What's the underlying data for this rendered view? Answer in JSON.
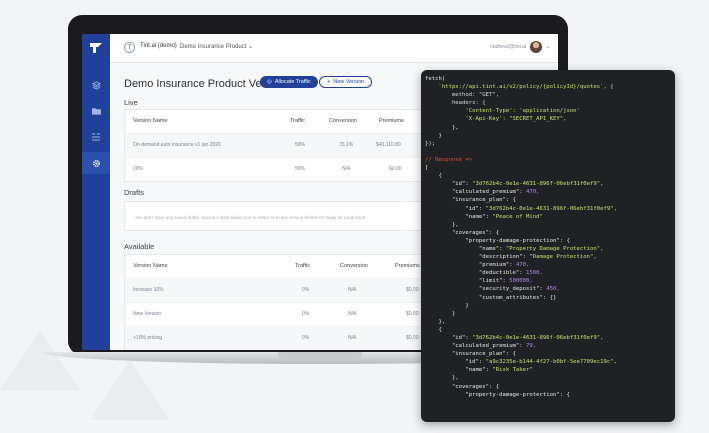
{
  "header": {
    "org_badge": "T",
    "org_name": "Tint.ai (demo)",
    "product_select": "Demo Insurance Product",
    "user_email": "matheus@tint.ai"
  },
  "page": {
    "title": "Demo Insurance Product Versions",
    "allocate_label": "Allocate Traffic",
    "new_version_label": "New Version"
  },
  "live": {
    "title": "Live",
    "columns": [
      "Version Name",
      "Traffic",
      "Conversion",
      "Premiums"
    ],
    "rows": [
      {
        "name": "On-demand auto insurance v1 jan 2020",
        "traffic": "50%",
        "conversion": "75.1%",
        "premiums": "$40,110.80"
      },
      {
        "name": "20%",
        "traffic": "50%",
        "conversion": "N/A",
        "premiums": "$0.00"
      }
    ]
  },
  "drafts": {
    "title": "Drafts",
    "empty": "You don't have any saved drafts. Saving a draft allows you to return to a new version before it's ready for production."
  },
  "available": {
    "title": "Available",
    "columns": [
      "Version Name",
      "Traffic",
      "Conversion",
      "Premiums"
    ],
    "rows": [
      {
        "name": "Increase 10%",
        "traffic": "0%",
        "conversion": "N/A",
        "premiums": "$0.00"
      },
      {
        "name": "New Version",
        "traffic": "0%",
        "conversion": "N/A",
        "premiums": "$0.00"
      },
      {
        "name": "+10% pricing",
        "traffic": "0%",
        "conversion": "N/A",
        "premiums": "$0.00"
      }
    ]
  },
  "code": {
    "request": [
      "fetch(",
      "    `https://api.tint.ai/v2/policy/{policyId}/quotes`, {",
      "        method: \"GET\",",
      "        headers: {",
      "            'Content-Type': 'application/json'",
      "            'X-Api-Key': \"SECRET_API_KEY\",",
      "        },",
      "    }",
      "});"
    ],
    "response_comment": "// Response =>",
    "response": [
      "[",
      "    {",
      "        \"id\": \"3d762b4c-0e1e-4631-896f-06ebf31f0ef9\",",
      "        \"calculated_premium\": 470,",
      "        \"insurance_plan\": {",
      "            \"id\": \"3d762b4c-0e1e-4631-896f-06ebf31f0ef9\",",
      "            \"name\": \"Peace of Mind\"",
      "        },",
      "        \"coverages\": {",
      "            \"property-damage-protection\": {",
      "                \"name\": \"Property Damage Protection\",",
      "                \"description\": \"Damage Protection\",",
      "                \"premium\": 470,",
      "                \"deductible\": 1500,",
      "                \"limit\": 500000,",
      "                \"security_deposit\": 450,",
      "                \"custom_attributes\": {}",
      "            }",
      "        }",
      "    },",
      "    {",
      "        \"id\": \"3d762b4c-0e1e-4631-896f-06ebf31f0ef9\",",
      "        \"calculated_premium\": 79,",
      "        \"insurance_plan\": {",
      "            \"id\": \"a9c3235e-b144-4f27-b0bf-5ee7709ec19c\",",
      "            \"name\": \"Risk Taker\"",
      "        },",
      "        \"coverages\": {",
      "            \"property-damage-protection\": {"
    ]
  }
}
